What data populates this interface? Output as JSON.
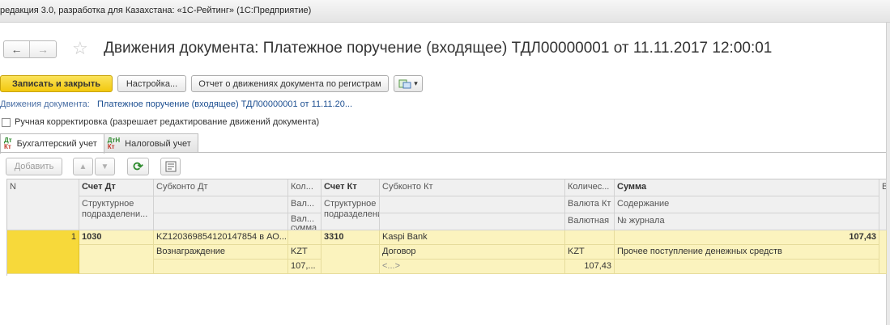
{
  "window": {
    "title": "редакция 3.0, разработка для Казахстана: «1С-Рейтинг» (1С:Предприятие)"
  },
  "nav": {
    "back": "←",
    "forward": "→",
    "favorite": "☆"
  },
  "header": {
    "title": "Движения документа: Платежное поручение (входящее) ТДЛ00000001 от 11.11.2017 12:00:01"
  },
  "toolbar": {
    "save_close": "Записать и закрыть",
    "settings": "Настройка...",
    "report": "Отчет о движениях документа по регистрам",
    "more": "▾"
  },
  "document": {
    "label": "Движения документа:",
    "value": "Платежное поручение (входящее) ТДЛ00000001 от 11.11.20..."
  },
  "manual_edit": {
    "label": "Ручная корректировка (разрешает редактирование движений документа)",
    "checked": false
  },
  "tabs": [
    {
      "label": "Бухгалтерский учет",
      "icon_top": "Дт",
      "icon_bottom": "Кт"
    },
    {
      "label": "Налоговый учет",
      "icon_top": "ДтН",
      "icon_bottom": "Кт"
    }
  ],
  "table_toolbar": {
    "add": "Добавить",
    "up": "▲",
    "down": "▼",
    "refresh": "⟳"
  },
  "table": {
    "headers": {
      "n": "N",
      "account_dt": "Счет Дт",
      "subconto_dt": "Субконто Дт",
      "qty_dt": "Кол...",
      "account_kt": "Счет Кт",
      "subconto_kt": "Субконто Кт",
      "qty_kt": "Количес...",
      "sum": "Сумма",
      "extra": "Ви",
      "division_dt": "Структурное подразделени...",
      "currency_dt": "Вал...",
      "currency_sum_dt": "Вал... сумма",
      "division_kt": "Структурное подразделени...",
      "currency_kt": "Валюта Кт",
      "content": "Содержание",
      "currency_sum_kt": "Валютная",
      "journal": "№ журнала"
    },
    "rows": [
      {
        "n": "1",
        "account_dt": "1030",
        "subconto_dt_1": "KZ120369854120147854 в АО...",
        "subconto_dt_2": "Вознаграждение",
        "currency_dt": "KZT",
        "currency_sum_dt": "107,...",
        "account_kt": "3310",
        "subconto_kt_1": "Kaspi Bank",
        "subconto_kt_2": "Договор",
        "subconto_kt_3": "<...>",
        "currency_kt": "KZT",
        "currency_sum_kt": "107,43",
        "sum": "107,43",
        "content": "Прочее поступление денежных средств"
      }
    ]
  }
}
